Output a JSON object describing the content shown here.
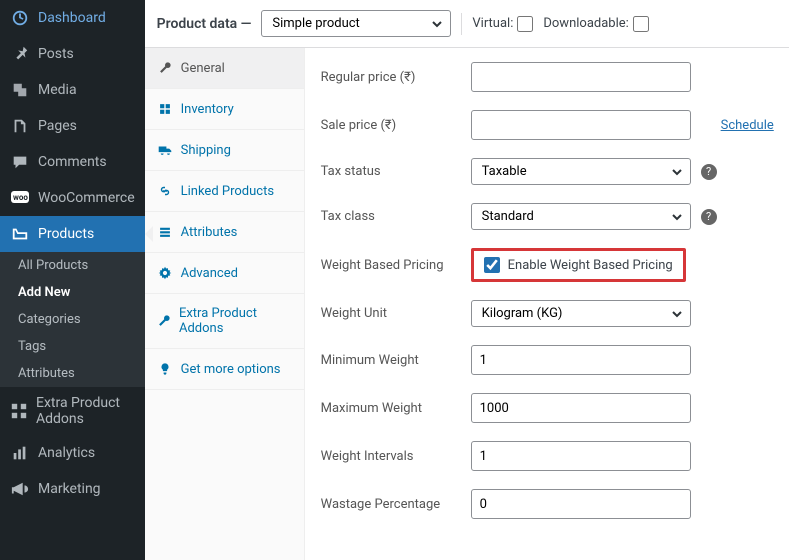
{
  "sidebar": {
    "items": [
      {
        "label": "Dashboard"
      },
      {
        "label": "Posts"
      },
      {
        "label": "Media"
      },
      {
        "label": "Pages"
      },
      {
        "label": "Comments"
      },
      {
        "label": "WooCommerce"
      },
      {
        "label": "Products"
      },
      {
        "label": "Extra Product Addons"
      },
      {
        "label": "Analytics"
      },
      {
        "label": "Marketing"
      }
    ],
    "sub_products": [
      {
        "label": "All Products"
      },
      {
        "label": "Add New"
      },
      {
        "label": "Categories"
      },
      {
        "label": "Tags"
      },
      {
        "label": "Attributes"
      }
    ]
  },
  "header": {
    "title": "Product data —",
    "product_type": "Simple product",
    "virtual_label": "Virtual:",
    "downloadable_label": "Downloadable:"
  },
  "tabs": [
    {
      "label": "General"
    },
    {
      "label": "Inventory"
    },
    {
      "label": "Shipping"
    },
    {
      "label": "Linked Products"
    },
    {
      "label": "Attributes"
    },
    {
      "label": "Advanced"
    },
    {
      "label": "Extra Product Addons"
    },
    {
      "label": "Get more options"
    }
  ],
  "fields": {
    "regular_price_label": "Regular price (₹)",
    "regular_price_value": "",
    "sale_price_label": "Sale price (₹)",
    "sale_price_value": "",
    "schedule_label": "Schedule",
    "tax_status_label": "Tax status",
    "tax_status_value": "Taxable",
    "tax_class_label": "Tax class",
    "tax_class_value": "Standard",
    "wbp_label": "Weight Based Pricing",
    "wbp_check_label": "Enable Weight Based Pricing",
    "weight_unit_label": "Weight Unit",
    "weight_unit_value": "Kilogram (KG)",
    "min_weight_label": "Minimum Weight",
    "min_weight_value": "1",
    "max_weight_label": "Maximum Weight",
    "max_weight_value": "1000",
    "intervals_label": "Weight Intervals",
    "intervals_value": "1",
    "wastage_label": "Wastage Percentage",
    "wastage_value": "0"
  }
}
